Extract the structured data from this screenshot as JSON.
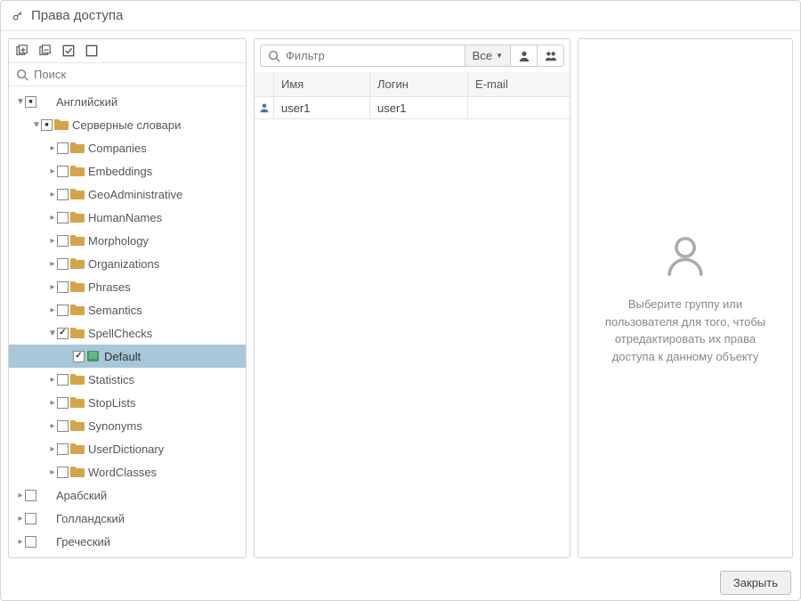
{
  "dialog": {
    "title": "Права доступа",
    "close": "Закрыть"
  },
  "left": {
    "search_placeholder": "Поиск",
    "tree": [
      {
        "id": "english",
        "label": "Английский",
        "depth": 0,
        "cb": "mixed",
        "expanded": true,
        "icon": "none"
      },
      {
        "id": "server-dicts",
        "label": "Серверные словари",
        "depth": 1,
        "cb": "mixed",
        "expanded": true,
        "icon": "folder"
      },
      {
        "id": "companies",
        "label": "Companies",
        "depth": 2,
        "cb": "empty",
        "arrow": true,
        "icon": "folder"
      },
      {
        "id": "embeddings",
        "label": "Embeddings",
        "depth": 2,
        "cb": "empty",
        "arrow": true,
        "icon": "folder"
      },
      {
        "id": "geoadmin",
        "label": "GeoAdministrative",
        "depth": 2,
        "cb": "empty",
        "arrow": true,
        "icon": "folder"
      },
      {
        "id": "humannames",
        "label": "HumanNames",
        "depth": 2,
        "cb": "empty",
        "arrow": true,
        "icon": "folder"
      },
      {
        "id": "morphology",
        "label": "Morphology",
        "depth": 2,
        "cb": "empty",
        "arrow": true,
        "icon": "folder"
      },
      {
        "id": "organizations",
        "label": "Organizations",
        "depth": 2,
        "cb": "empty",
        "arrow": true,
        "icon": "folder"
      },
      {
        "id": "phrases",
        "label": "Phrases",
        "depth": 2,
        "cb": "empty",
        "arrow": true,
        "icon": "folder"
      },
      {
        "id": "semantics",
        "label": "Semantics",
        "depth": 2,
        "cb": "empty",
        "arrow": true,
        "icon": "folder"
      },
      {
        "id": "spellchecks",
        "label": "SpellChecks",
        "depth": 2,
        "cb": "checked",
        "expanded": true,
        "icon": "folder"
      },
      {
        "id": "default",
        "label": "Default",
        "depth": 3,
        "cb": "checked",
        "arrow": false,
        "icon": "book",
        "selected": true
      },
      {
        "id": "statistics",
        "label": "Statistics",
        "depth": 2,
        "cb": "empty",
        "arrow": true,
        "icon": "folder"
      },
      {
        "id": "stoplists",
        "label": "StopLists",
        "depth": 2,
        "cb": "empty",
        "arrow": true,
        "icon": "folder"
      },
      {
        "id": "synonyms",
        "label": "Synonyms",
        "depth": 2,
        "cb": "empty",
        "arrow": true,
        "icon": "folder"
      },
      {
        "id": "userdict",
        "label": "UserDictionary",
        "depth": 2,
        "cb": "empty",
        "arrow": true,
        "icon": "folder"
      },
      {
        "id": "wordclasses",
        "label": "WordClasses",
        "depth": 2,
        "cb": "empty",
        "arrow": true,
        "icon": "folder"
      },
      {
        "id": "arabic",
        "label": "Арабский",
        "depth": 0,
        "cb": "empty",
        "arrow": true,
        "icon": "none"
      },
      {
        "id": "dutch",
        "label": "Голландский",
        "depth": 0,
        "cb": "empty",
        "arrow": true,
        "icon": "none"
      },
      {
        "id": "greek",
        "label": "Греческий",
        "depth": 0,
        "cb": "empty",
        "arrow": true,
        "icon": "none"
      }
    ]
  },
  "center": {
    "filter_placeholder": "Фильтр",
    "filter_dd": "Все",
    "columns": {
      "name": "Имя",
      "login": "Логин",
      "email": "E-mail"
    },
    "rows": [
      {
        "name": "user1",
        "login": "user1",
        "email": ""
      }
    ]
  },
  "right": {
    "text": "Выберите группу или пользователя для того, чтобы отредактировать их права доступа к данному объекту"
  }
}
